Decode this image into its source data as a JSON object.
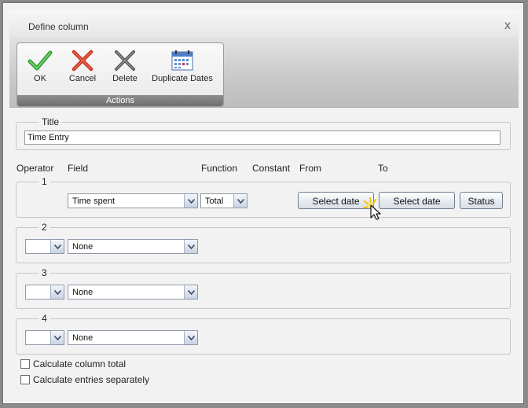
{
  "window": {
    "title": "Define column",
    "close_glyph": "x"
  },
  "ribbon": {
    "group_label": "Actions",
    "buttons": [
      {
        "label": "OK",
        "icon": "check-icon"
      },
      {
        "label": "Cancel",
        "icon": "cancel-x-icon"
      },
      {
        "label": "Delete",
        "icon": "delete-x-icon"
      },
      {
        "label": "Duplicate Dates",
        "icon": "calendar-icon"
      }
    ]
  },
  "title_section": {
    "legend": "Title",
    "value": "Time Entry"
  },
  "columns": {
    "operator": "Operator",
    "field": "Field",
    "function": "Function",
    "constant": "Constant",
    "from": "From",
    "to": "To"
  },
  "rows": [
    {
      "legend": "1",
      "field": "Time spent",
      "function": "Total",
      "from_button": "Select date",
      "to_button": "Select date",
      "status_button": "Status"
    },
    {
      "legend": "2",
      "operator": "",
      "field": "None"
    },
    {
      "legend": "3",
      "operator": "",
      "field": "None"
    },
    {
      "legend": "4",
      "operator": "",
      "field": "None"
    }
  ],
  "options": {
    "calc_total": {
      "label": "Calculate column total",
      "checked": false
    },
    "calc_separate": {
      "label": "Calculate entries separately",
      "checked": false
    }
  },
  "colors": {
    "accent_green": "#3aa53a",
    "accent_red": "#d23a2a",
    "border_blue": "#6f7d91"
  }
}
